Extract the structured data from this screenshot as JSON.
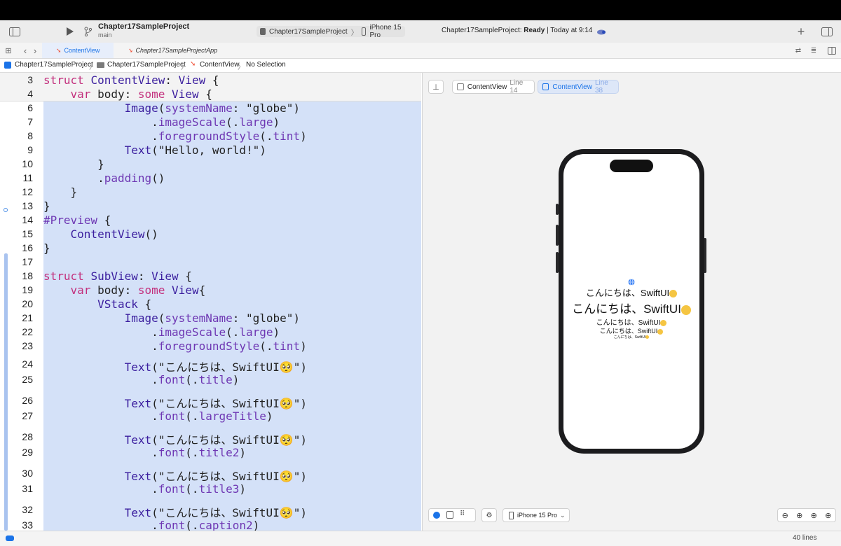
{
  "toolbar": {
    "project_name": "Chapter17SampleProject",
    "branch": "main",
    "scheme": "Chapter17SampleProject",
    "destination": "iPhone 15 Pro",
    "status_project": "Chapter17SampleProject:",
    "status_state": "Ready",
    "status_time": "| Today at 9:14"
  },
  "tabs": [
    {
      "label": "ContentView",
      "active": true
    },
    {
      "label": "Chapter17SampleProjectApp",
      "active": false
    }
  ],
  "breadcrumb": [
    "Chapter17SampleProject",
    "Chapter17SampleProject",
    "ContentView",
    "No Selection"
  ],
  "code_lines": [
    {
      "n": "3",
      "t": "struct ContentView: View {"
    },
    {
      "n": "4",
      "t": "    var body: some View {"
    },
    {
      "n": "6",
      "t": "            Image(systemName: \"globe\")"
    },
    {
      "n": "7",
      "t": "                .imageScale(.large)"
    },
    {
      "n": "8",
      "t": "                .foregroundStyle(.tint)"
    },
    {
      "n": "9",
      "t": "            Text(\"Hello, world!\")"
    },
    {
      "n": "10",
      "t": "        }"
    },
    {
      "n": "11",
      "t": "        .padding()"
    },
    {
      "n": "12",
      "t": "    }"
    },
    {
      "n": "13",
      "t": "}"
    },
    {
      "n": "14",
      "t": "#Preview {"
    },
    {
      "n": "15",
      "t": "    ContentView()"
    },
    {
      "n": "16",
      "t": "}"
    },
    {
      "n": "17",
      "t": ""
    },
    {
      "n": "18",
      "t": "struct SubView: View {"
    },
    {
      "n": "19",
      "t": "    var body: some View{"
    },
    {
      "n": "20",
      "t": "        VStack {"
    },
    {
      "n": "21",
      "t": "            Image(systemName: \"globe\")"
    },
    {
      "n": "22",
      "t": "                .imageScale(.large)"
    },
    {
      "n": "23",
      "t": "                .foregroundStyle(.tint)"
    },
    {
      "n": "24",
      "t": "            Text(\"こんにちは、SwiftUI🥺\")"
    },
    {
      "n": "25",
      "t": "                .font(.title)"
    },
    {
      "n": "26",
      "t": "            Text(\"こんにちは、SwiftUI🥺\")"
    },
    {
      "n": "27",
      "t": "                .font(.largeTitle)"
    },
    {
      "n": "28",
      "t": "            Text(\"こんにちは、SwiftUI🥺\")"
    },
    {
      "n": "29",
      "t": "                .font(.title2)"
    },
    {
      "n": "30",
      "t": "            Text(\"こんにちは、SwiftUI🥺\")"
    },
    {
      "n": "31",
      "t": "                .font(.title3)"
    },
    {
      "n": "32",
      "t": "            Text(\"こんにちは、SwiftUI🥺\")"
    },
    {
      "n": "33",
      "t": "                .font(.caption2)"
    }
  ],
  "preview": {
    "pin_label": "pin-icon",
    "pills": [
      {
        "name": "ContentView",
        "line": "Line 14",
        "active": false
      },
      {
        "name": "ContentView",
        "line": "Line 38",
        "active": true
      }
    ],
    "texts": [
      "こんにちは、SwiftUI",
      "こんにちは、SwiftUI",
      "こんにちは、SwiftUI",
      "こんにちは、SwiftUI",
      "こんにちは、SwiftUI"
    ],
    "device_menu": "iPhone 15 Pro"
  },
  "status": {
    "lines": "40 lines"
  },
  "colors": {
    "accent": "#1a73e8",
    "selection": "#d4e1f8",
    "keyword": "#c3307d"
  }
}
